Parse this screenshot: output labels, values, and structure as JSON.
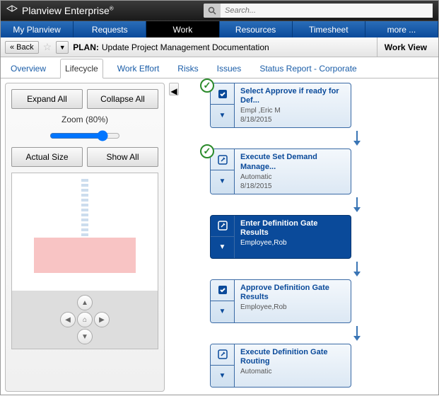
{
  "brand": "Planview Enterprise",
  "search": {
    "placeholder": "Search..."
  },
  "mainnav": [
    "My Planview",
    "Requests",
    "Work",
    "Resources",
    "Timesheet",
    "more ..."
  ],
  "mainnav_active": 2,
  "subbar": {
    "back": "« Back",
    "plan_prefix": "PLAN:",
    "plan_title": "Update Project Management Documentation",
    "view": "Work View"
  },
  "tabs": [
    "Overview",
    "Lifecycle",
    "Work Effort",
    "Risks",
    "Issues",
    "Status Report - Corporate"
  ],
  "tabs_active": 1,
  "sidepanel": {
    "expand": "Expand All",
    "collapse": "Collapse All",
    "zoom_label": "Zoom (80%)",
    "actual": "Actual Size",
    "showall": "Show All"
  },
  "nodes": [
    {
      "title": "Select Approve if ready for Def...",
      "sub": "Empl ,Eric M",
      "date": "8/18/2015",
      "icon": "check",
      "complete": true,
      "selected": false
    },
    {
      "title": "Execute Set Demand Manage...",
      "sub": "Automatic",
      "date": "8/18/2015",
      "icon": "edit",
      "complete": true,
      "selected": false
    },
    {
      "title": "Enter Definition Gate Results",
      "sub": "Employee,Rob",
      "date": "",
      "icon": "edit",
      "complete": false,
      "selected": true
    },
    {
      "title": "Approve Definition Gate Results",
      "sub": "Employee,Rob",
      "date": "",
      "icon": "check",
      "complete": false,
      "selected": false
    },
    {
      "title": "Execute Definition Gate Routing",
      "sub": "Automatic",
      "date": "",
      "icon": "edit",
      "complete": false,
      "selected": false
    }
  ]
}
